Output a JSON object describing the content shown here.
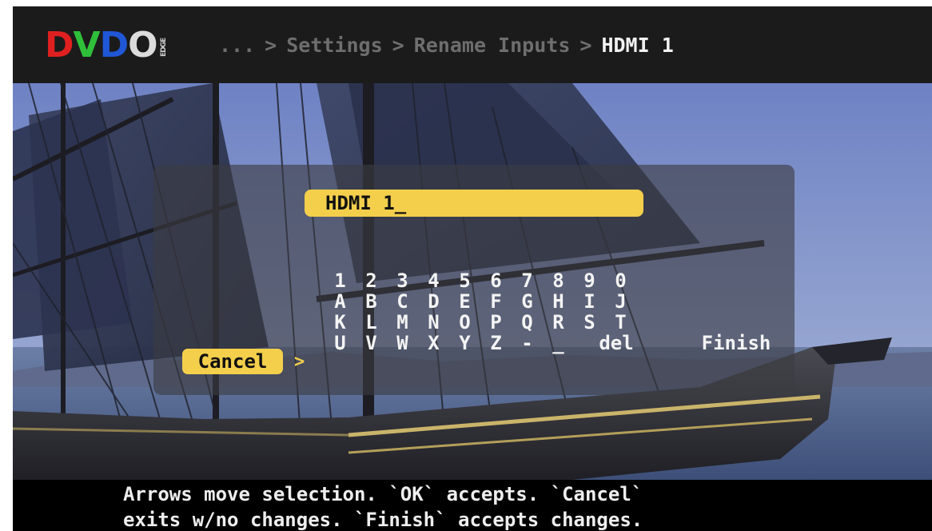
{
  "logo": {
    "letters": [
      "D",
      "V",
      "D",
      "O"
    ],
    "sub": "EDGE"
  },
  "breadcrumb": {
    "ellipsis": "...",
    "separator": ">",
    "items": [
      "Settings",
      "Rename Inputs"
    ],
    "current": "HDMI 1"
  },
  "name_field": {
    "value": "HDMI 1_"
  },
  "keyboard": {
    "rows": [
      [
        "1",
        "2",
        "3",
        "4",
        "5",
        "6",
        "7",
        "8",
        "9",
        "0"
      ],
      [
        "A",
        "B",
        "C",
        "D",
        "E",
        "F",
        "G",
        "H",
        "I",
        "J"
      ],
      [
        "K",
        "L",
        "M",
        "N",
        "O",
        "P",
        "Q",
        "R",
        "S",
        "T"
      ],
      [
        "U",
        "V",
        "W",
        "X",
        "Y",
        "Z",
        "-",
        "_"
      ]
    ],
    "del_label": "del",
    "finish_label": "Finish",
    "cancel_label": "Cancel",
    "selection_arrow": ">"
  },
  "help": {
    "line1": "Arrows move selection. `OK` accepts. `Cancel`",
    "line2": "exits w/no changes. `Finish` accepts changes."
  },
  "colors": {
    "highlight": "#f3cf4c",
    "header_bg": "#1b1b1b",
    "panel_bg": "rgba(60,60,66,0.62)"
  }
}
